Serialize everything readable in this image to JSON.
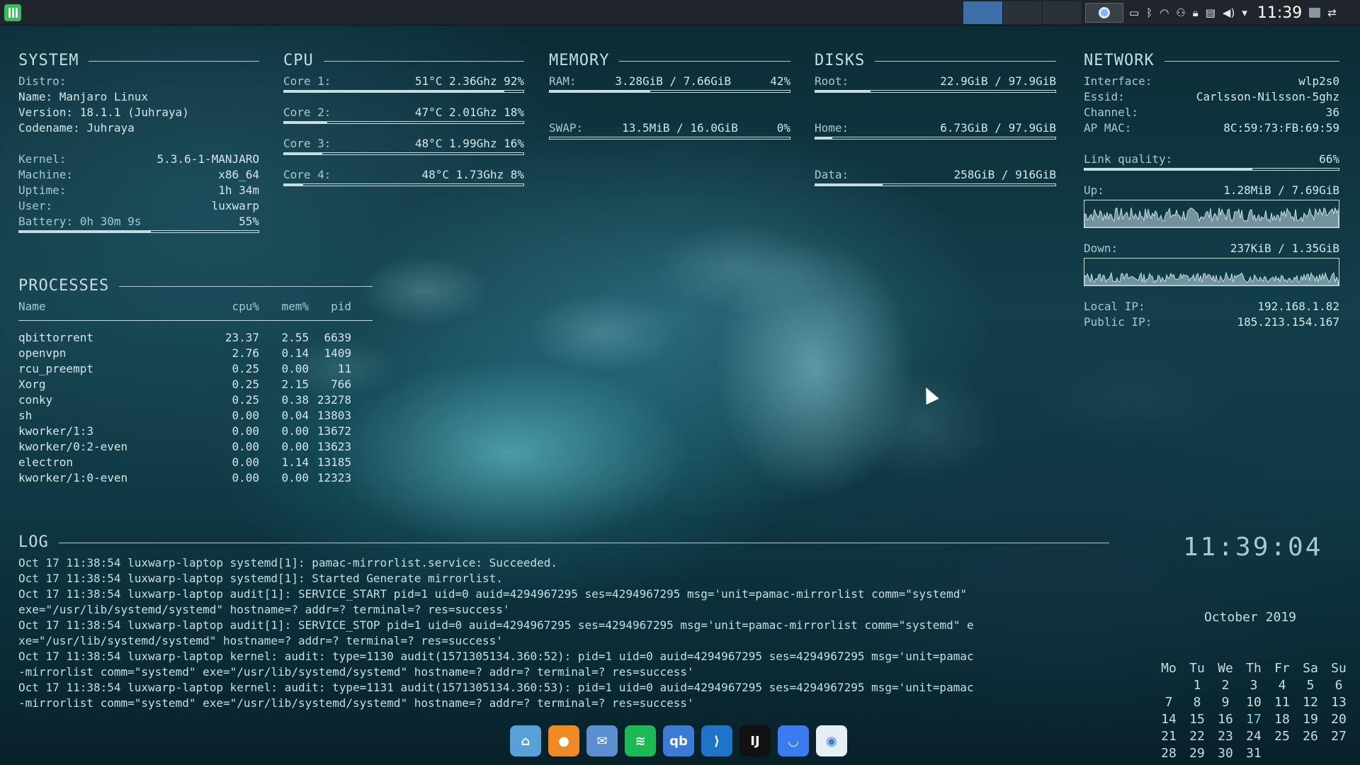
{
  "panel": {
    "clock": "11:39",
    "pager_count": 4,
    "tray_icons": [
      "battery-icon",
      "bluetooth-icon",
      "wifi-icon",
      "network-manager-icon",
      "lock-icon",
      "clipboard-icon",
      "volume-icon",
      "expand-icon"
    ]
  },
  "system": {
    "title": "SYSTEM",
    "distro_label": "Distro:",
    "name": "Name: Manjaro Linux",
    "version": "Version: 18.1.1 (Juhraya)",
    "codename": "Codename: Juhraya",
    "kernel_label": "Kernel:",
    "kernel": "5.3.6-1-MANJARO",
    "machine_label": "Machine:",
    "machine": "x86_64",
    "uptime_label": "Uptime:",
    "uptime": "1h 34m",
    "user_label": "User:",
    "user": "luxwarp",
    "battery_label": "Battery: 0h 30m 9s",
    "battery": "55%",
    "battery_pct": 55
  },
  "cpu": {
    "title": "CPU",
    "cores": [
      {
        "label": "Core 1:",
        "value": "51°C 2.36Ghz 92%",
        "pct": 92
      },
      {
        "label": "Core 2:",
        "value": "47°C 2.01Ghz 18%",
        "pct": 18
      },
      {
        "label": "Core 3:",
        "value": "48°C 1.99Ghz 16%",
        "pct": 16
      },
      {
        "label": "Core 4:",
        "value": "48°C 1.73Ghz 8%",
        "pct": 8
      }
    ]
  },
  "memory": {
    "title": "MEMORY",
    "ram_label": "RAM:",
    "ram": "3.28GiB / 7.66GiB",
    "ram_pct_text": "42%",
    "ram_pct": 42,
    "swap_label": "SWAP:",
    "swap": "13.5MiB / 16.0GiB",
    "swap_pct_text": "0%",
    "swap_pct": 0
  },
  "disks": {
    "title": "DISKS",
    "items": [
      {
        "label": "Root:",
        "value": "22.9GiB / 97.9GiB",
        "pct": 23
      },
      {
        "label": "Home:",
        "value": "6.73GiB / 97.9GiB",
        "pct": 7
      },
      {
        "label": "Data:",
        "value": "258GiB / 916GiB",
        "pct": 28
      }
    ]
  },
  "network": {
    "title": "NETWORK",
    "interface_label": "Interface:",
    "interface": "wlp2s0",
    "essid_label": "Essid:",
    "essid": "Carlsson-Nilsson-5ghz",
    "channel_label": "Channel:",
    "channel": "36",
    "apmac_label": "AP MAC:",
    "apmac": "8C:59:73:FB:69:59",
    "link_label": "Link quality:",
    "link": "66%",
    "link_pct": 66,
    "up_label": "Up:",
    "up": "1.28MiB / 7.69GiB",
    "down_label": "Down:",
    "down": "237KiB / 1.35GiB",
    "localip_label": "Local IP:",
    "localip": "192.168.1.82",
    "publicip_label": "Public IP:",
    "publicip": "185.213.154.167"
  },
  "processes": {
    "title": "PROCESSES",
    "headers": [
      "Name",
      "cpu%",
      "mem%",
      "pid"
    ],
    "rows": [
      [
        "qbittorrent",
        "23.37",
        "2.55",
        "6639"
      ],
      [
        "openvpn",
        "2.76",
        "0.14",
        "1409"
      ],
      [
        "rcu_preempt",
        "0.25",
        "0.00",
        "11"
      ],
      [
        "Xorg",
        "0.25",
        "2.15",
        "766"
      ],
      [
        "conky",
        "0.25",
        "0.38",
        "23278"
      ],
      [
        "sh",
        "0.00",
        "0.04",
        "13803"
      ],
      [
        "kworker/1:3",
        "0.00",
        "0.00",
        "13672"
      ],
      [
        "kworker/0:2-even",
        "0.00",
        "0.00",
        "13623"
      ],
      [
        "electron",
        "0.00",
        "1.14",
        "13185"
      ],
      [
        "kworker/1:0-even",
        "0.00",
        "0.00",
        "12323"
      ]
    ]
  },
  "log": {
    "title": "LOG",
    "lines": [
      "Oct 17 11:38:54 luxwarp-laptop systemd[1]: pamac-mirrorlist.service: Succeeded.",
      "Oct 17 11:38:54 luxwarp-laptop systemd[1]: Started Generate mirrorlist.",
      "Oct 17 11:38:54 luxwarp-laptop audit[1]: SERVICE_START pid=1 uid=0 auid=4294967295 ses=4294967295 msg='unit=pamac-mirrorlist comm=\"systemd\"",
      "exe=\"/usr/lib/systemd/systemd\" hostname=? addr=? terminal=? res=success'",
      "Oct 17 11:38:54 luxwarp-laptop audit[1]: SERVICE_STOP pid=1 uid=0 auid=4294967295 ses=4294967295 msg='unit=pamac-mirrorlist comm=\"systemd\" e",
      "xe=\"/usr/lib/systemd/systemd\" hostname=? addr=? terminal=? res=success'",
      "Oct 17 11:38:54 luxwarp-laptop kernel: audit: type=1130 audit(1571305134.360:52): pid=1 uid=0 auid=4294967295 ses=4294967295 msg='unit=pamac",
      "-mirrorlist comm=\"systemd\" exe=\"/usr/lib/systemd/systemd\" hostname=? addr=? terminal=? res=success'",
      "Oct 17 11:38:54 luxwarp-laptop kernel: audit: type=1131 audit(1571305134.360:53): pid=1 uid=0 auid=4294967295 ses=4294967295 msg='unit=pamac",
      "-mirrorlist comm=\"systemd\" exe=\"/usr/lib/systemd/systemd\" hostname=? addr=? terminal=? res=success'"
    ]
  },
  "clock": {
    "time": "11:39:04"
  },
  "calendar": {
    "month": "October 2019",
    "weekdays": [
      "Mo",
      "Tu",
      "We",
      "Th",
      "Fr",
      "Sa",
      "Su"
    ],
    "first_weekday_index": 1,
    "days_in_month": 31,
    "today": 17
  },
  "dock": {
    "apps": [
      {
        "name": "home-folder-icon",
        "color": "#5aa0d8",
        "glyph": "⌂"
      },
      {
        "name": "firefox-icon",
        "color": "#f08a24",
        "glyph": "●"
      },
      {
        "name": "thunderbird-icon",
        "color": "#5b8fd0",
        "glyph": "✉"
      },
      {
        "name": "spotify-icon",
        "color": "#1db954",
        "glyph": "≋"
      },
      {
        "name": "qbittorrent-icon",
        "color": "#3b7bd6",
        "glyph": "qb"
      },
      {
        "name": "vscode-icon",
        "color": "#1e74c8",
        "glyph": "⟩"
      },
      {
        "name": "intellij-icon",
        "color": "#111111",
        "glyph": "IJ"
      },
      {
        "name": "pamac-icon",
        "color": "#3a7cf0",
        "glyph": "◡"
      },
      {
        "name": "settings-toggle-icon",
        "color": "#e6eef5",
        "glyph": "◉"
      }
    ]
  }
}
